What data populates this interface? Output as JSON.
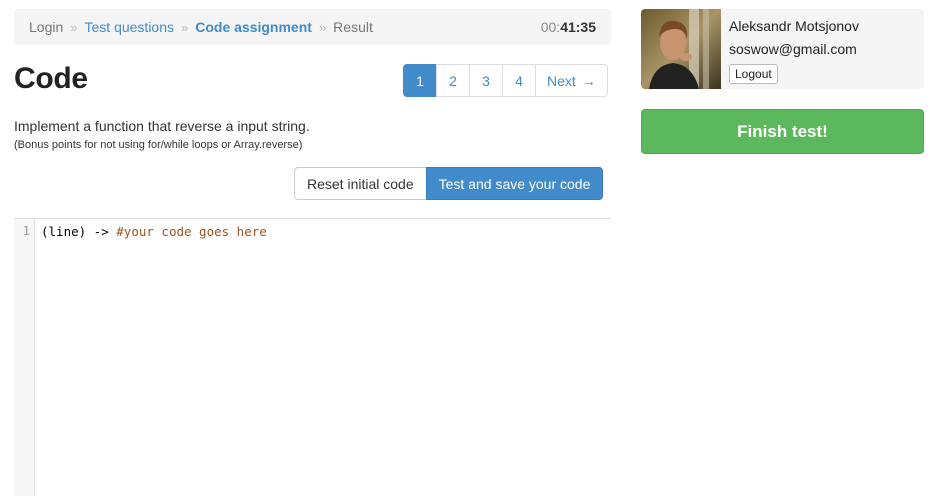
{
  "breadcrumb": {
    "items": [
      "Login",
      "Test questions",
      "Code assignment",
      "Result"
    ],
    "separator": "»"
  },
  "timer": {
    "prefix": "00:",
    "time": "41:35"
  },
  "page": {
    "title": "Code"
  },
  "pagination": {
    "pages": [
      "1",
      "2",
      "3",
      "4"
    ],
    "active": "1",
    "next_label": "Next",
    "next_icon": "→"
  },
  "task": {
    "description": "Implement a function that reverse a input string.",
    "note": "(Bonus points for not using for/while loops or Array.reverse)"
  },
  "actions": {
    "reset_label": "Reset initial code",
    "save_label": "Test and save your code"
  },
  "editor": {
    "line_number": "1",
    "code": "(line) -> ",
    "comment": "#your code goes here"
  },
  "user": {
    "name": "Aleksandr Motsjonov",
    "email": "soswow@gmail.com",
    "logout_label": "Logout"
  },
  "finish": {
    "label": "Finish test!"
  },
  "colors": {
    "primary": "#428bca",
    "success": "#5cb85c"
  }
}
